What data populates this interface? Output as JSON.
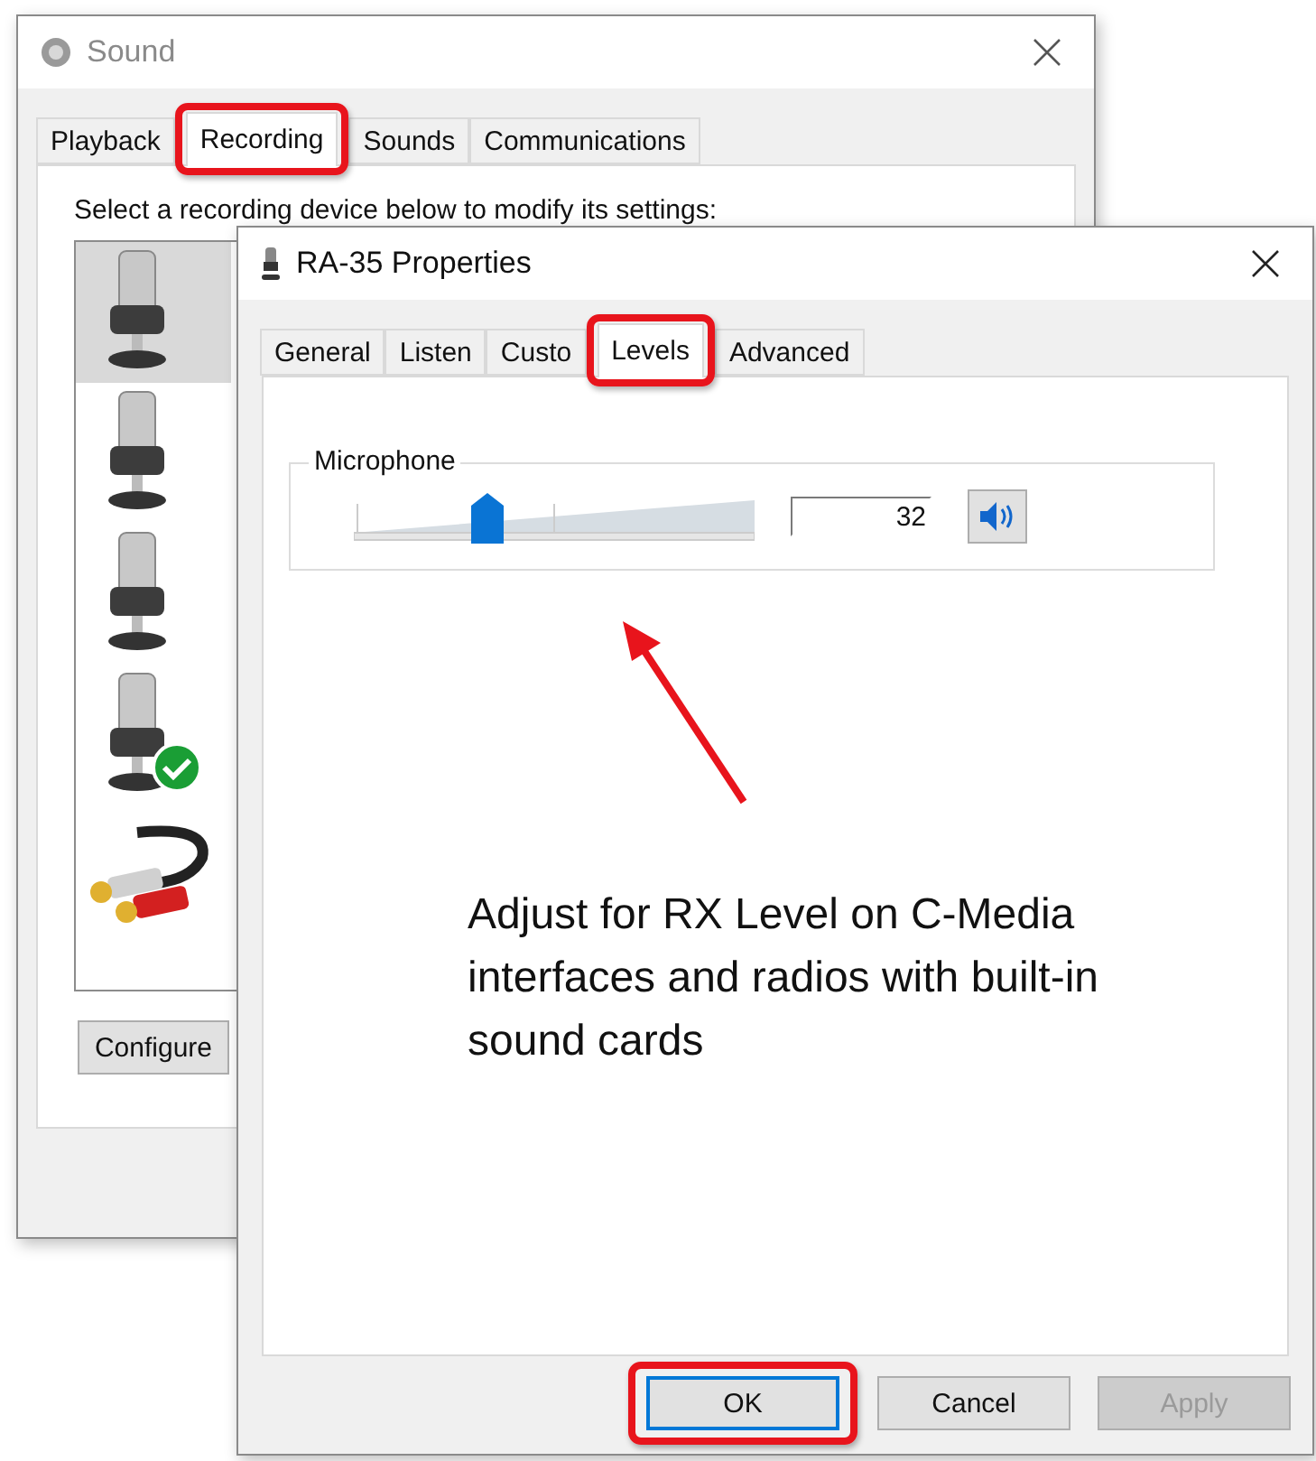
{
  "back_window": {
    "title": "Sound",
    "tabs": [
      {
        "label": "Playback",
        "selected": false,
        "highlighted": false
      },
      {
        "label": "Recording",
        "selected": true,
        "highlighted": true
      },
      {
        "label": "Sounds",
        "selected": false,
        "highlighted": false
      },
      {
        "label": "Communications",
        "selected": false,
        "highlighted": false
      }
    ],
    "instruction": "Select a recording device below to modify its settings:",
    "devices": [
      {
        "kind": "microphone",
        "selected": true,
        "default": false
      },
      {
        "kind": "microphone",
        "selected": false,
        "default": false
      },
      {
        "kind": "microphone",
        "selected": false,
        "default": false
      },
      {
        "kind": "microphone",
        "selected": false,
        "default": true
      },
      {
        "kind": "cable",
        "selected": false,
        "default": false
      }
    ],
    "configure_button": "Configure"
  },
  "front_window": {
    "title": "RA-35 Properties",
    "tabs": [
      {
        "label": "General",
        "selected": false,
        "highlighted": false
      },
      {
        "label": "Listen",
        "selected": false,
        "highlighted": false
      },
      {
        "label": "Custo",
        "selected": false,
        "highlighted": false
      },
      {
        "label": "Levels",
        "selected": true,
        "highlighted": true
      },
      {
        "label": "Advanced",
        "selected": false,
        "highlighted": false
      }
    ],
    "level_group": {
      "label": "Microphone",
      "level": 0.32,
      "value": "32",
      "muted": false
    },
    "buttons": [
      {
        "label": "OK",
        "default": true,
        "disabled": false,
        "highlighted": true
      },
      {
        "label": "Cancel",
        "default": false,
        "disabled": false,
        "highlighted": false
      },
      {
        "label": "Apply",
        "default": false,
        "disabled": true,
        "highlighted": false
      }
    ]
  },
  "callout": "Adjust for RX Level on C-Media interfaces and radios with built-in sound cards"
}
